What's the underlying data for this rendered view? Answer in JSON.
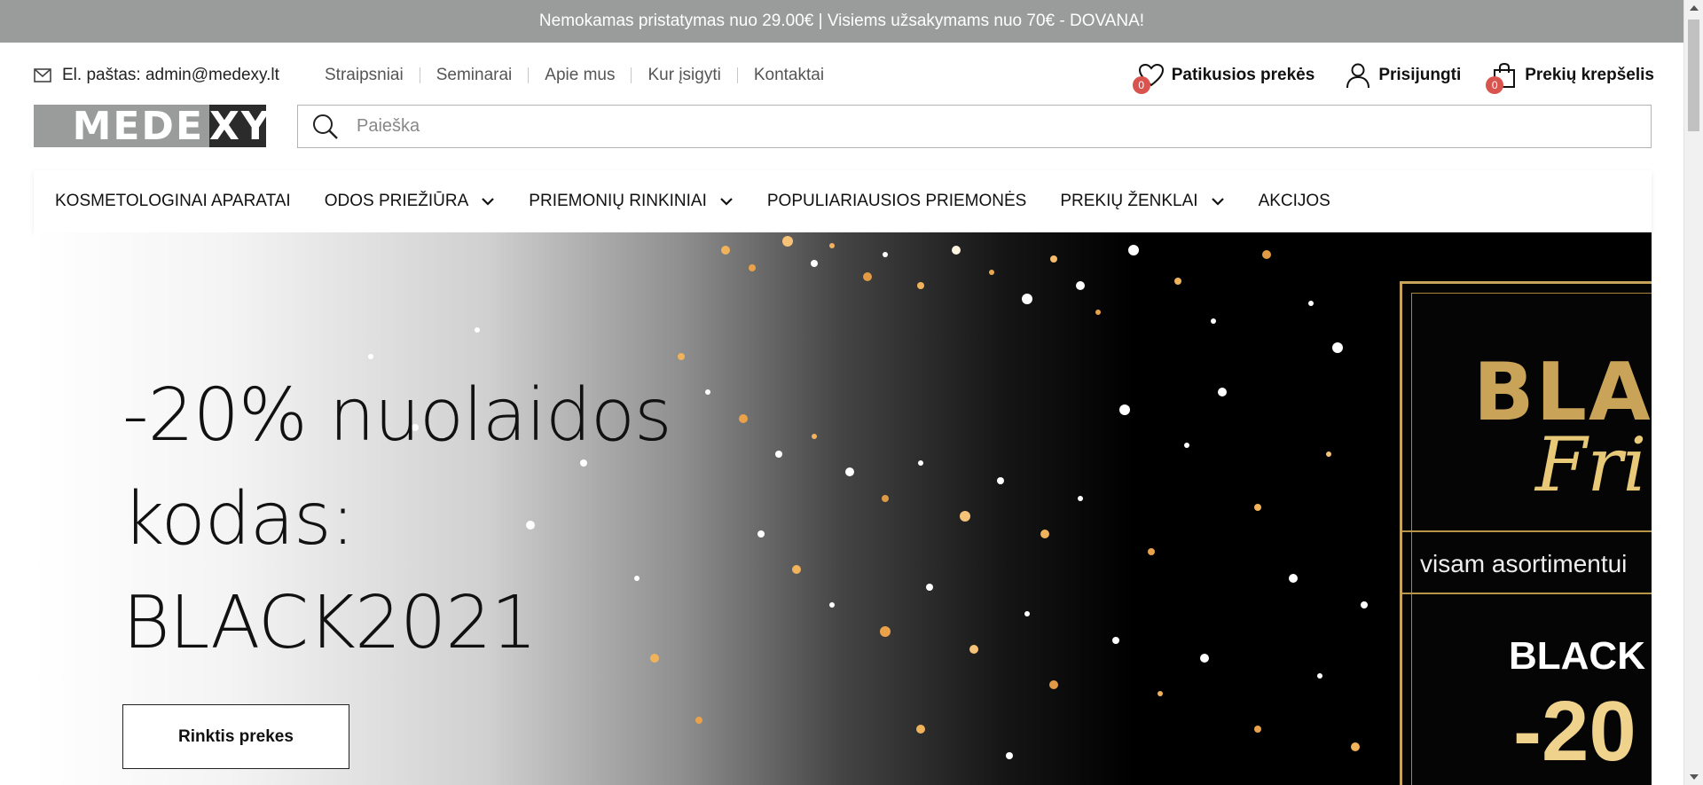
{
  "announcement": "Nemokamas pristatymas nuo 29.00€ | Visiems užsakymams nuo 70€ - DOVANA!",
  "contact": {
    "icon": "envelope-icon",
    "text": "El. paštas: admin@medexy.lt"
  },
  "top_links": [
    "Straipsniai",
    "Seminarai",
    "Apie mus",
    "Kur įsigyti",
    "Kontaktai"
  ],
  "user_actions": {
    "wishlist": {
      "label": "Patikusios prekės",
      "count": "0",
      "icon": "heart-icon"
    },
    "login": {
      "label": "Prisijungti",
      "icon": "user-icon"
    },
    "cart": {
      "label": "Prekių krepšelis",
      "count": "0",
      "icon": "shopping-bag-icon"
    }
  },
  "logo": {
    "left": "MEDE",
    "right": "XY"
  },
  "search": {
    "placeholder": "Paieška",
    "icon": "search-icon"
  },
  "main_nav": [
    {
      "label": "KOSMETOLOGINAI APARATAI",
      "dropdown": false
    },
    {
      "label": "ODOS PRIEŽIŪRA",
      "dropdown": true
    },
    {
      "label": "PRIEMONIŲ RINKINIAI",
      "dropdown": true
    },
    {
      "label": "POPULIARIAUSIOS PRIEMONĖS",
      "dropdown": false
    },
    {
      "label": "PREKIŲ ŽENKLAI",
      "dropdown": true
    },
    {
      "label": "AKCIJOS",
      "dropdown": false
    }
  ],
  "hero": {
    "title_lines": [
      "-20% nuolaidos",
      "kodas:",
      "BLACK2021"
    ],
    "button": "Rinktis prekes",
    "promo": {
      "word1": "BLA",
      "word2": "Fri",
      "tagline": "visam asortimentui",
      "code": "BLACK",
      "discount": "-20"
    }
  },
  "colors": {
    "topbar_bg": "#9a9b9b",
    "badge": "#d9534f",
    "gold": "#c9a458",
    "hero_dark": "#000000"
  }
}
